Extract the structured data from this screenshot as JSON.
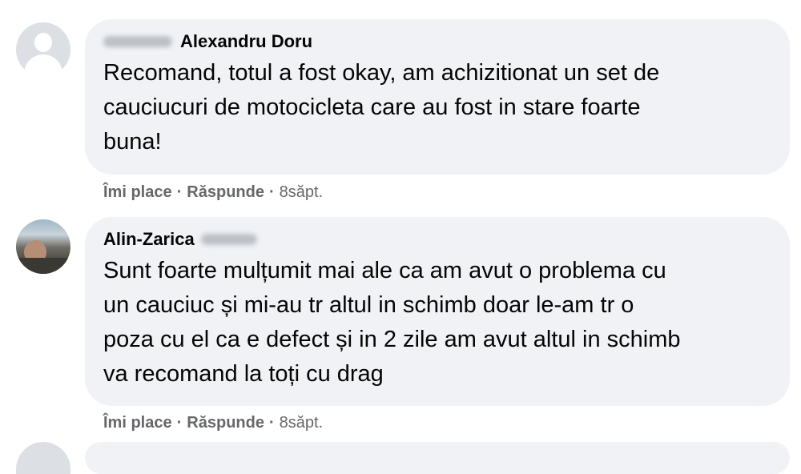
{
  "comments": [
    {
      "author": "Alexandru Doru",
      "text_lines": [
        "Recomand, totul a fost okay, am achizitionat un set de",
        "cauciucuri de motocicleta care au fost in stare foarte",
        "buna!"
      ],
      "like": "Îmi place",
      "reply": "Răspunde",
      "time": "8săpt."
    },
    {
      "author": "Alin-Zarica",
      "text_lines": [
        "Sunt foarte mulțumit mai ale ca am avut o problema cu",
        "un cauciuc și mi-au tr altul in schimb doar le-am tr o",
        "poza cu el ca e defect și in 2 zile am avut altul in schimb",
        "va recomand la toți cu drag"
      ],
      "like": "Îmi place",
      "reply": "Răspunde",
      "time": "8săpt."
    }
  ],
  "separator": "·"
}
